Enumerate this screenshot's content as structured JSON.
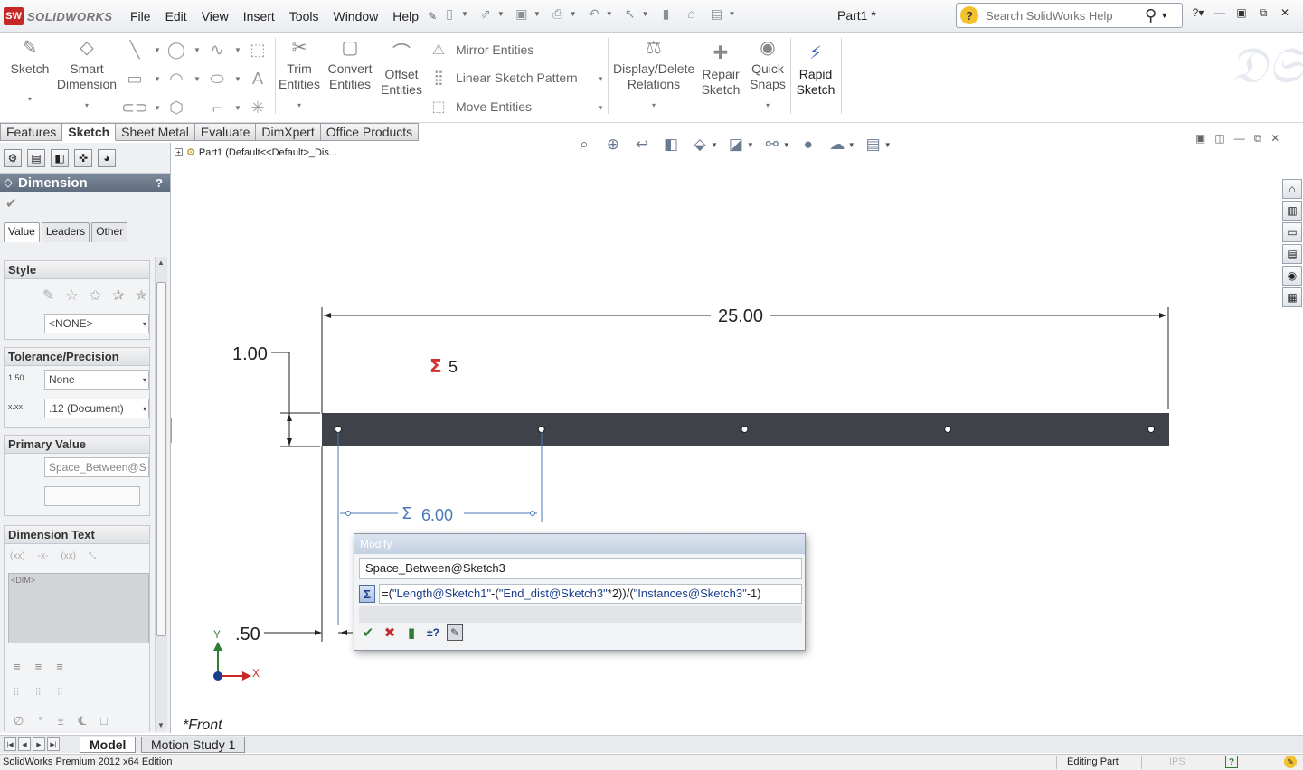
{
  "app": {
    "logo_text": "SOLIDWORKS",
    "logo_box": "SW",
    "doc_title": "Part1 *"
  },
  "menu": [
    "File",
    "Edit",
    "View",
    "Insert",
    "Tools",
    "Window",
    "Help"
  ],
  "help_search": {
    "placeholder": "Search SolidWorks Help"
  },
  "ribbon": {
    "sketch": "Sketch",
    "smart_dimension": [
      "Smart",
      "Dimension"
    ],
    "trim": [
      "Trim",
      "Entities"
    ],
    "convert": [
      "Convert",
      "Entities"
    ],
    "offset": [
      "Offset",
      "Entities"
    ],
    "mirror": "Mirror Entities",
    "linear_pattern": "Linear Sketch Pattern",
    "move": "Move Entities",
    "display_delete": [
      "Display/Delete",
      "Relations"
    ],
    "repair": [
      "Repair",
      "Sketch"
    ],
    "quick_snaps": [
      "Quick",
      "Snaps"
    ],
    "rapid_sketch": [
      "Rapid",
      "Sketch"
    ]
  },
  "cm_tabs": [
    "Features",
    "Sketch",
    "Sheet Metal",
    "Evaluate",
    "DimXpert",
    "Office Products"
  ],
  "cm_active_tab": "Sketch",
  "feature_tree": {
    "root": "Part1  (Default<<Default>_Dis..."
  },
  "property_manager": {
    "title": "Dimension",
    "tabs": [
      "Value",
      "Leaders",
      "Other"
    ],
    "style": {
      "title": "Style",
      "favorite": "<NONE>"
    },
    "tolerance": {
      "title": "Tolerance/Precision",
      "tolerance_type": "None",
      "precision": ".12 (Document)"
    },
    "primary_value": {
      "title": "Primary Value",
      "name": "Space_Between@S",
      "value": ""
    },
    "dimension_text": {
      "title": "Dimension Text",
      "placeholder": "<DIM>"
    }
  },
  "sketch": {
    "dim_overall": "25.00",
    "dim_height": "1.00",
    "dim_spacing": "6.00",
    "dim_offset": ".50",
    "instances_label": "5",
    "view_label": "*Front",
    "axis_x": "X",
    "axis_y": "Y"
  },
  "modify_dialog": {
    "title": "Modify",
    "dimension_name": "Space_Between@Sketch3",
    "expr_prefix": "=(",
    "expr_length": "\"Length@Sketch1\"",
    "expr_mid1": "-(",
    "expr_end": "\"End_dist@Sketch3\"",
    "expr_mid2": "*2))/(",
    "expr_inst": "\"Instances@Sketch3\"",
    "expr_suffix": "-1)"
  },
  "bottom_tabs": [
    "Model",
    "Motion Study 1"
  ],
  "status": {
    "edition": "SolidWorks Premium 2012 x64 Edition",
    "mode": "Editing Part",
    "units": "IPS"
  },
  "colors": {
    "accent": "#1a3e8c",
    "bar_fill": "#3f4349",
    "sigma_red": "#d32f2f",
    "dim_blue": "#4a7ab8"
  }
}
